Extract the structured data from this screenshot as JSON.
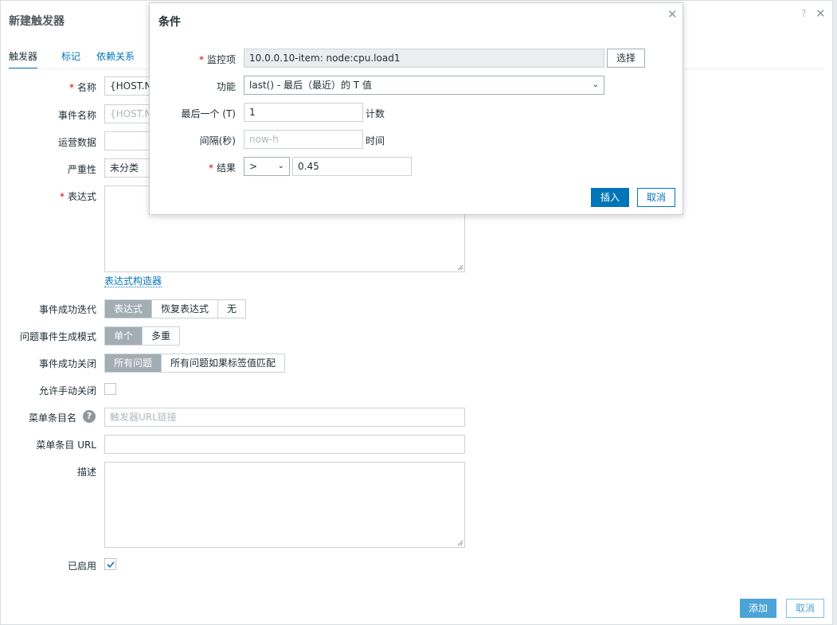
{
  "window": {
    "title": "新建触发器",
    "help": "?",
    "close": "✕"
  },
  "tabs": [
    {
      "label": "触发器",
      "active": true
    },
    {
      "label": "标记",
      "active": false
    },
    {
      "label": "依赖关系",
      "active": false
    }
  ],
  "form": {
    "name_label": "名称",
    "name_value": "{HOST.NA",
    "event_name_label": "事件名称",
    "event_name_placeholder": "{HOST.NA",
    "opdata_label": "运营数据",
    "severity_label": "严重性",
    "severity_value": "未分类",
    "expression_label": "表达式",
    "expression_builder_link": "表达式构造器",
    "ok_event_gen_label": "事件成功迭代",
    "ok_event_gen_options": [
      "表达式",
      "恢复表达式",
      "无"
    ],
    "ok_event_gen_selected": 0,
    "problem_mode_label": "问题事件生成模式",
    "problem_mode_options": [
      "单个",
      "多重"
    ],
    "problem_mode_selected": 0,
    "ok_close_label": "事件成功关闭",
    "ok_close_options": [
      "所有问题",
      "所有问题如果标签值匹配"
    ],
    "ok_close_selected": 0,
    "manual_close_label": "允许手动关闭",
    "manual_close_checked": false,
    "url_name_label": "菜单条目名",
    "url_name_placeholder": "触发器URL链接",
    "url_label": "菜单条目 URL",
    "description_label": "描述",
    "enabled_label": "已启用",
    "enabled_checked": true,
    "add_button": "添加",
    "cancel_button": "取消"
  },
  "dialog": {
    "title": "条件",
    "close": "✕",
    "item_label": "监控项",
    "item_value": "10.0.0.10-item: node:cpu.load1",
    "select_button": "选择",
    "function_label": "功能",
    "function_value": "last() - 最后（最近）的 T 值",
    "last_t_label": "最后一个 (T)",
    "last_t_value": "1",
    "last_t_suffix": "计数",
    "shift_label": "间隔(秒)",
    "shift_placeholder": "now-h",
    "shift_suffix": "时间",
    "result_label": "结果",
    "result_operator": ">",
    "result_value": "0.45",
    "insert_button": "插入",
    "cancel_button": "取消"
  },
  "colors": {
    "accent": "#0275b8",
    "required": "#d40000",
    "segment_active": "#a2adb4"
  }
}
